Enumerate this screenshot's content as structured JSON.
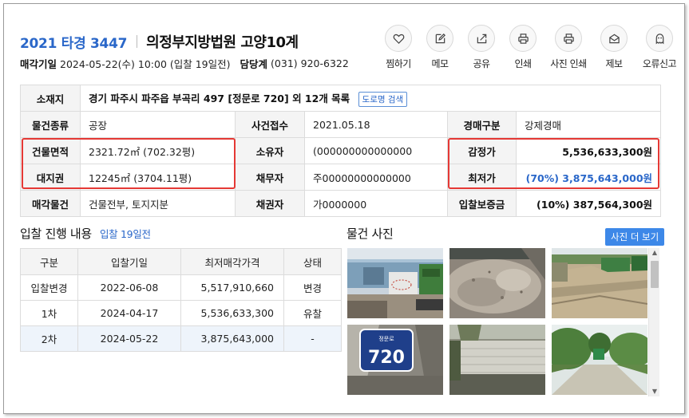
{
  "header": {
    "case_no": "2021 타경 3447",
    "court": "의정부지방법원 고양10계",
    "sale_date_label": "매각기일",
    "sale_date_value": "2024-05-22(수) 10:00 (입찰 19일전)",
    "contact_label": "담당계",
    "contact_value": "(031) 920-6322"
  },
  "actions": [
    {
      "label": "찜하기",
      "icon": "heart-icon"
    },
    {
      "label": "메모",
      "icon": "pencil-icon"
    },
    {
      "label": "공유",
      "icon": "share-icon"
    },
    {
      "label": "인쇄",
      "icon": "printer-icon"
    },
    {
      "label": "사진 인쇄",
      "icon": "printer-icon"
    },
    {
      "label": "제보",
      "icon": "envelope-icon"
    },
    {
      "label": "오류신고",
      "icon": "ghost-icon"
    }
  ],
  "info": {
    "address_label": "소재지",
    "address_value": "경기 파주시 파주읍 부곡리 497 [정문로 720] 외 12개 목록",
    "road_search": "도로명 검색",
    "type_label": "물건종류",
    "type_value": "공장",
    "received_label": "사건접수",
    "received_value": "2021.05.18",
    "auction_type_label": "경매구분",
    "auction_type_value": "강제경매",
    "building_area_label": "건물면적",
    "building_area_value": "2321.72㎡ (702.32평)",
    "owner_label": "소유자",
    "owner_value": "(000000000000000",
    "appraisal_label": "감정가",
    "appraisal_value": "5,536,633,300원",
    "land_label": "대지권",
    "land_value": "12245㎡ (3704.11평)",
    "debtor_label": "채무자",
    "debtor_value": "주00000000000000",
    "min_price_label": "최저가",
    "min_price_value": "(70%) 3,875,643,000원",
    "sale_object_label": "매각물건",
    "sale_object_value": "건물전부, 토지지분",
    "creditor_label": "채권자",
    "creditor_value": "가0000000",
    "deposit_label": "입찰보증금",
    "deposit_value": "(10%) 387,564,300원"
  },
  "bid_section": {
    "title": "입찰 진행 내용",
    "subtitle": "입찰 19일전",
    "columns": [
      "구분",
      "입찰기일",
      "최저매각가격",
      "상태"
    ],
    "rows": [
      {
        "round": "입찰변경",
        "date": "2022-06-08",
        "price": "5,517,910,660",
        "status": "변경"
      },
      {
        "round": "1차",
        "date": "2024-04-17",
        "price": "5,536,633,300",
        "status": "유찰"
      },
      {
        "round": "2차",
        "date": "2024-05-22",
        "price": "3,875,643,000",
        "status": "-"
      }
    ]
  },
  "photo_section": {
    "title": "물건 사진",
    "more_button": "사진 더 보기",
    "sign_street": "정문로",
    "sign_number": "720"
  },
  "colors": {
    "accent": "#2a67c9",
    "highlight_box": "#e53935",
    "button_blue": "#3d88e8"
  }
}
